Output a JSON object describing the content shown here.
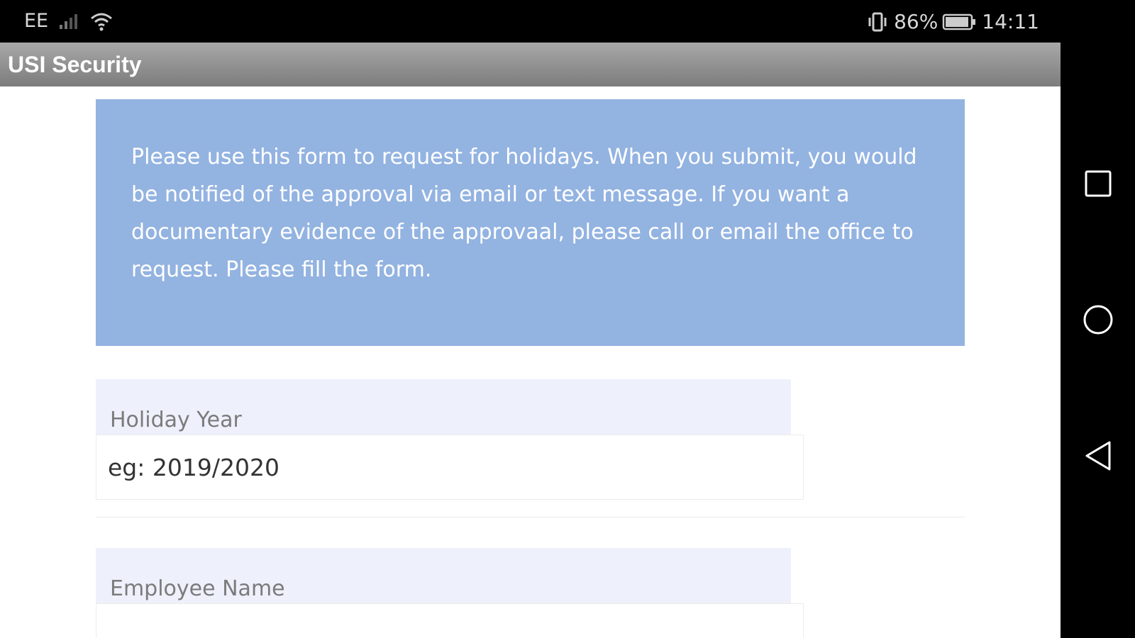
{
  "status_bar": {
    "carrier": "EE",
    "battery_percent": "86%",
    "time": "14:11",
    "icons": [
      "signal-icon",
      "wifi-icon",
      "vibrate-icon",
      "battery-icon"
    ]
  },
  "app_bar": {
    "title": "USI Security",
    "color": "#8e8e8e"
  },
  "info_box": {
    "text": "Please use this form to request for holidays. When you submit, you would be notified of the approval via email or text message. If you want a documentary evidence of the approvaal, please call or email the office to request. Please fill the form.",
    "background": "#93b3e1"
  },
  "form": {
    "holiday_year": {
      "label": "Holiday Year",
      "value": "",
      "placeholder": "eg: 2019/2020"
    },
    "employee_name": {
      "label": "Employee Name",
      "value": "",
      "placeholder": ""
    }
  },
  "nav_bar": {
    "buttons": [
      "recents-square-icon",
      "home-circle-icon",
      "back-triangle-icon"
    ]
  }
}
